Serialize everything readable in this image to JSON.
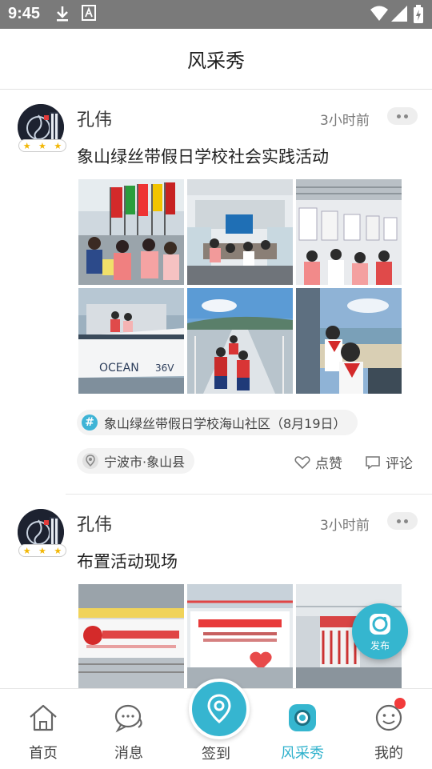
{
  "status_bar": {
    "time": "9:45"
  },
  "header": {
    "title": "风采秀"
  },
  "posts": [
    {
      "author": "孔伟",
      "time": "3小时前",
      "text": "象山绿丝带假日学校社会实践活动",
      "topic": "象山绿丝带假日学校海山社区（8月19日）",
      "location": "宁波市·象山县",
      "like_label": "点赞",
      "comment_label": "评论",
      "photos": [
        "flags-gathering",
        "meeting-room",
        "exhibition-hall",
        "boat-trip",
        "pier-walk",
        "seaside-window"
      ]
    },
    {
      "author": "孔伟",
      "time": "3小时前",
      "text": "布置活动现场",
      "photos": [
        "event-banner",
        "stage-backdrop",
        "mall-atrium"
      ]
    }
  ],
  "fab": {
    "label": "发布"
  },
  "tabs": [
    {
      "label": "首页",
      "icon": "home-icon"
    },
    {
      "label": "消息",
      "icon": "chat-icon"
    },
    {
      "label": "签到",
      "icon": "location-pin-icon"
    },
    {
      "label": "风采秀",
      "icon": "camera-icon",
      "active": true
    },
    {
      "label": "我的",
      "icon": "profile-icon",
      "badge": true
    }
  ],
  "colors": {
    "accent": "#36b5d0",
    "badge": "#f23b3b",
    "star": "#f2b705"
  }
}
